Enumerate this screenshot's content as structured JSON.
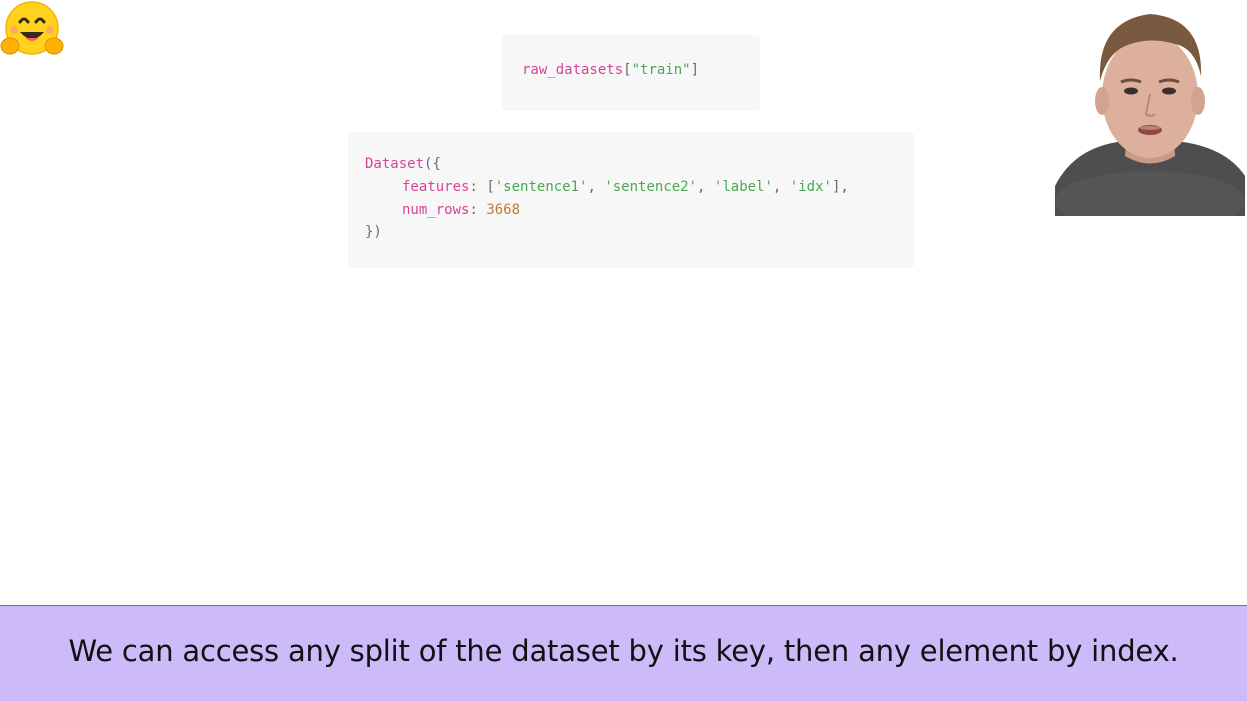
{
  "slide": {
    "code_input": {
      "var": "raw_datasets",
      "open_bracket": "[",
      "key": "\"train\"",
      "close_bracket": "]"
    },
    "code_output": {
      "class_name": "Dataset",
      "open": "({",
      "features_key": "features",
      "colon": ":",
      "list_open": "[",
      "features": [
        "'sentence1'",
        "'sentence2'",
        "'label'",
        "'idx'"
      ],
      "list_close": "],",
      "num_rows_key": "num_rows",
      "num_rows_value": "3668",
      "close": "})"
    }
  },
  "caption": {
    "text": "We can access any split of the dataset by its key, then any element by index."
  },
  "icons": {
    "logo": "hugging-face-emoji-icon",
    "presenter": "presenter-video-avatar"
  },
  "colors": {
    "caption_background": "#ccbaf9",
    "code_keyword": "#d6449a",
    "code_string": "#4aa853",
    "code_number": "#c27a36"
  }
}
